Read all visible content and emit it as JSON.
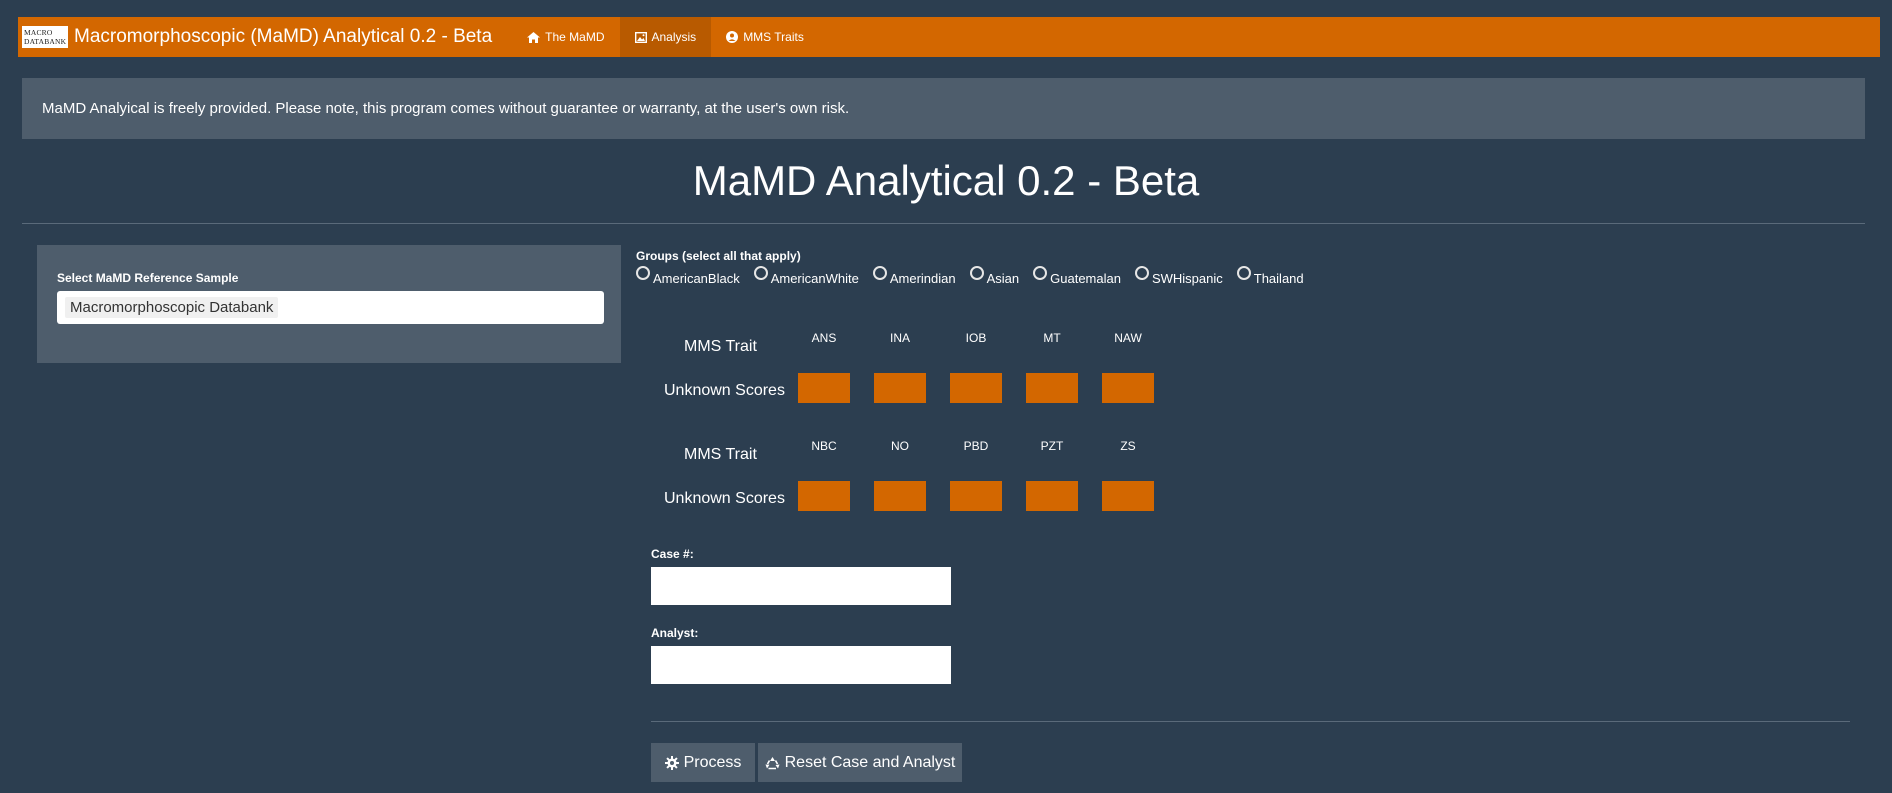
{
  "navbar": {
    "logo_line1": "MACRO",
    "logo_line2": "DATABANK",
    "title": "Macromorphoscopic (MaMD) Analytical 0.2 - Beta",
    "tabs": [
      {
        "label": "The MaMD",
        "icon": "home-icon"
      },
      {
        "label": "Analysis",
        "icon": "picture-icon",
        "active": true
      },
      {
        "label": "MMS Traits",
        "icon": "user-circle-icon"
      }
    ]
  },
  "notice": "MaMD Analyical is freely provided. Please note, this program comes without guarantee or warranty, at the user's own risk.",
  "page_title": "MaMD Analytical 0.2 - Beta",
  "sidebar": {
    "label": "Select MaMD Reference Sample",
    "selected": "Macromorphoscopic Databank"
  },
  "groups": {
    "label": "Groups (select all that apply)",
    "options": [
      "AmericanBlack",
      "AmericanWhite",
      "Amerindian",
      "Asian",
      "Guatemalan",
      "SWHispanic",
      "Thailand"
    ]
  },
  "traits": {
    "row_label": "MMS Trait",
    "scores_label": "Unknown Scores",
    "row1": [
      "ANS",
      "INA",
      "IOB",
      "MT",
      "NAW"
    ],
    "row2": [
      "NBC",
      "NO",
      "PBD",
      "PZT",
      "ZS"
    ]
  },
  "case": {
    "label": "Case #:",
    "value": ""
  },
  "analyst": {
    "label": "Analyst:",
    "value": ""
  },
  "buttons": {
    "process": "Process",
    "reset": "Reset Case and Analyst"
  },
  "colors": {
    "background": "#2c3e50",
    "navbar": "#d36700",
    "panel": "#4e5d6c",
    "score_box": "#d36700"
  }
}
